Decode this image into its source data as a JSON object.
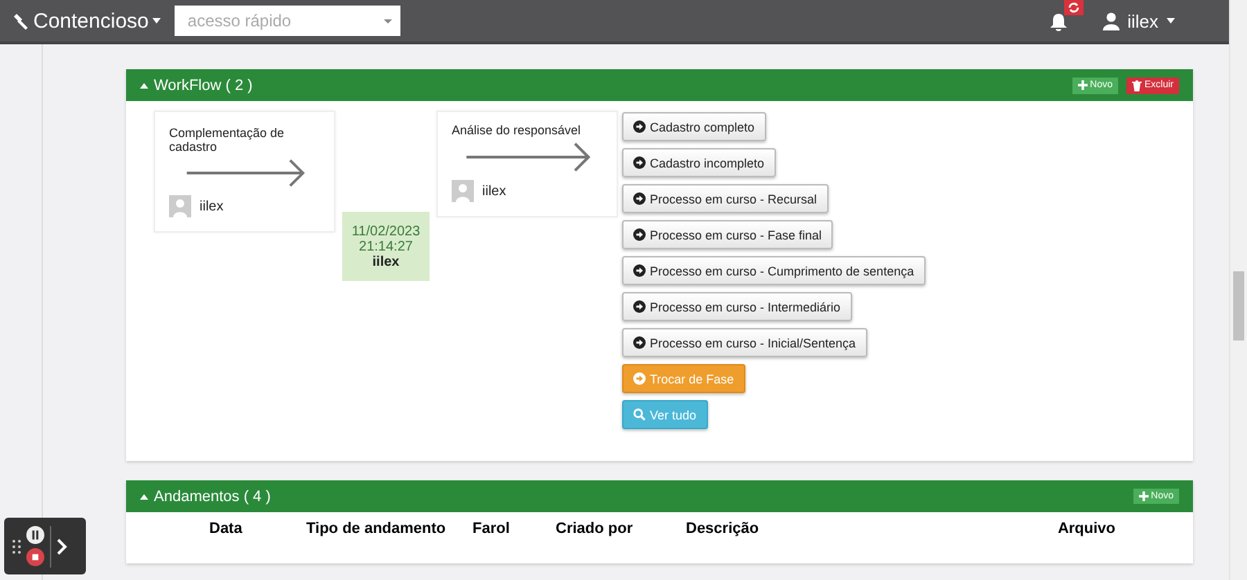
{
  "navbar": {
    "module": "Contencioso",
    "quick_access": {
      "placeholder": "acesso rápido"
    },
    "user": "iilex"
  },
  "workflow": {
    "title": "WorkFlow ( 2 )",
    "actions": [
      {
        "label": "Novo",
        "kind": "add"
      },
      {
        "label": "Excluir",
        "kind": "delete"
      }
    ],
    "stages": [
      {
        "name": "Complementação de cadastro",
        "user": "iilex"
      },
      {
        "name": "Análise do responsável",
        "user": "iilex"
      }
    ],
    "transition": {
      "date": "11/02/2023",
      "time": "21:14:27",
      "user": "iilex"
    },
    "options": [
      {
        "label": "Cadastro completo",
        "kind": "option"
      },
      {
        "label": "Cadastro incompleto",
        "kind": "option"
      },
      {
        "label": "Processo em curso - Recursal",
        "kind": "option"
      },
      {
        "label": "Processo em curso - Fase final",
        "kind": "option"
      },
      {
        "label": "Processo em curso - Cumprimento de sentença",
        "kind": "option"
      },
      {
        "label": "Processo em curso - Intermediário",
        "kind": "option"
      },
      {
        "label": "Processo em curso - Inicial/Sentença",
        "kind": "option"
      },
      {
        "label": "Trocar de Fase",
        "kind": "change"
      },
      {
        "label": "Ver tudo",
        "kind": "view"
      }
    ]
  },
  "andamentos": {
    "title": "Andamentos ( 4 )",
    "actions": [
      {
        "label": "Novo",
        "kind": "add"
      }
    ],
    "columns": [
      "Data",
      "Tipo de andamento",
      "Farol",
      "Criado por",
      "Descrição",
      "Arquivo"
    ]
  }
}
